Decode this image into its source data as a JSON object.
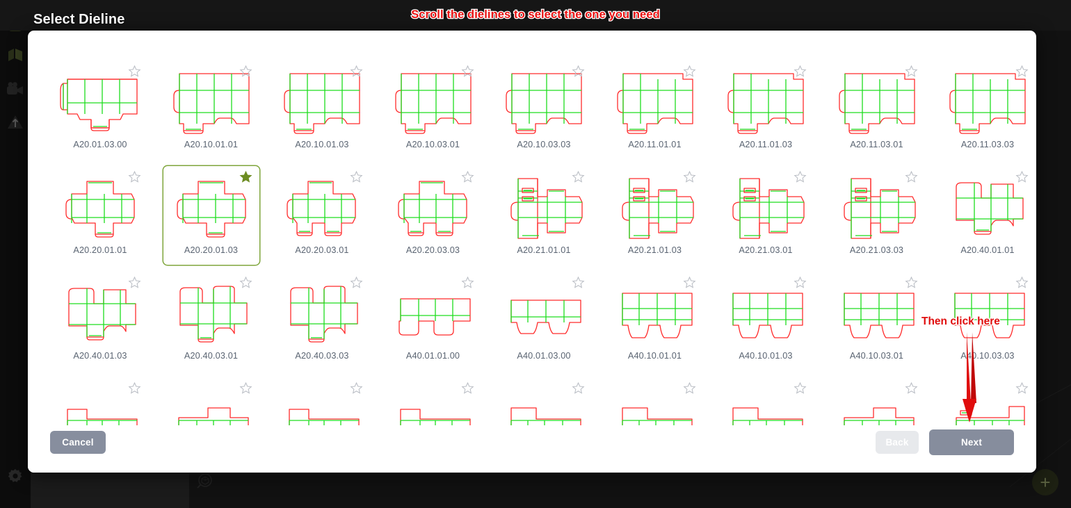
{
  "window": {
    "title": "Select Dieline",
    "background_color": "#111111"
  },
  "annotations": {
    "top_banner": "Scroll the dielines to select the one you need",
    "click_hint": "Then click here",
    "color": "#e81010"
  },
  "sidebar": {
    "items": [
      {
        "name": "app-logo-icon",
        "label": "logo"
      },
      {
        "name": "box-model-icon",
        "label": "3D box"
      },
      {
        "name": "camera-icon",
        "label": "camera"
      },
      {
        "name": "upload-icon",
        "label": "upload"
      }
    ],
    "bottom": {
      "name": "settings-gear-icon",
      "label": "settings"
    }
  },
  "canvas": {
    "view_icon": "3d-view-search-icon",
    "add_button": "+"
  },
  "dialog": {
    "selected_id": "A20.20.01.03",
    "accent_color": "#7fa63c",
    "rows": [
      {
        "items": [
          {
            "id": "A20.01.03.00",
            "shape": "tray_a",
            "favorite": false
          },
          {
            "id": "A20.10.01.01",
            "shape": "rste_a",
            "favorite": false
          },
          {
            "id": "A20.10.01.03",
            "shape": "rste_a",
            "favorite": false
          },
          {
            "id": "A20.10.03.01",
            "shape": "rste_a",
            "favorite": false
          },
          {
            "id": "A20.10.03.03",
            "shape": "rste_a",
            "favorite": false
          },
          {
            "id": "A20.11.01.01",
            "shape": "rste_b",
            "favorite": false
          },
          {
            "id": "A20.11.01.03",
            "shape": "rste_b",
            "favorite": false
          },
          {
            "id": "A20.11.03.01",
            "shape": "rste_b",
            "favorite": false
          },
          {
            "id": "A20.11.03.03",
            "shape": "rste_b",
            "favorite": false
          }
        ]
      },
      {
        "items": [
          {
            "id": "A20.20.01.01",
            "shape": "flap_a",
            "favorite": false
          },
          {
            "id": "A20.20.01.03",
            "shape": "flap_sel",
            "favorite": true
          },
          {
            "id": "A20.20.03.01",
            "shape": "flap_b",
            "favorite": false
          },
          {
            "id": "A20.20.03.03",
            "shape": "flap_b",
            "favorite": false
          },
          {
            "id": "A20.21.01.01",
            "shape": "lock_a",
            "favorite": false
          },
          {
            "id": "A20.21.01.03",
            "shape": "lock_a",
            "favorite": false
          },
          {
            "id": "A20.21.03.01",
            "shape": "lock_a",
            "favorite": false
          },
          {
            "id": "A20.21.03.03",
            "shape": "lock_a",
            "favorite": false
          },
          {
            "id": "A20.40.01.01",
            "shape": "ear_a",
            "favorite": false
          }
        ]
      },
      {
        "items": [
          {
            "id": "A20.40.01.03",
            "shape": "ear_a",
            "favorite": false
          },
          {
            "id": "A20.40.03.01",
            "shape": "ear_b",
            "favorite": false
          },
          {
            "id": "A20.40.03.03",
            "shape": "ear_b",
            "favorite": false
          },
          {
            "id": "A40.01.01.00",
            "shape": "plain_a",
            "favorite": false
          },
          {
            "id": "A40.01.03.00",
            "shape": "plain_b",
            "favorite": false
          },
          {
            "id": "A40.10.01.01",
            "shape": "plain_c",
            "favorite": false
          },
          {
            "id": "A40.10.01.03",
            "shape": "plain_c",
            "favorite": false
          },
          {
            "id": "A40.10.03.01",
            "shape": "plain_c",
            "favorite": false
          },
          {
            "id": "A40.10.03.03",
            "shape": "plain_c",
            "favorite": false
          }
        ]
      },
      {
        "items": [
          {
            "id": "",
            "shape": "part_a",
            "favorite": false
          },
          {
            "id": "",
            "shape": "part_b",
            "favorite": false
          },
          {
            "id": "",
            "shape": "part_a",
            "favorite": false
          },
          {
            "id": "",
            "shape": "part_a",
            "favorite": false
          },
          {
            "id": "",
            "shape": "part_c",
            "favorite": false
          },
          {
            "id": "",
            "shape": "part_c",
            "favorite": false
          },
          {
            "id": "",
            "shape": "part_c",
            "favorite": false
          },
          {
            "id": "",
            "shape": "part_b",
            "favorite": false
          },
          {
            "id": "",
            "shape": "part_d",
            "favorite": false
          }
        ]
      }
    ]
  },
  "footer": {
    "cancel_label": "Cancel",
    "back_label": "Back",
    "next_label": "Next",
    "back_disabled": true
  },
  "colors": {
    "dieline_cut": "#ff2b2b",
    "dieline_fold": "#1ddd1d",
    "label_text": "#5a6472",
    "button_primary": "#868d9d",
    "button_disabled": "#e7e9ec"
  }
}
